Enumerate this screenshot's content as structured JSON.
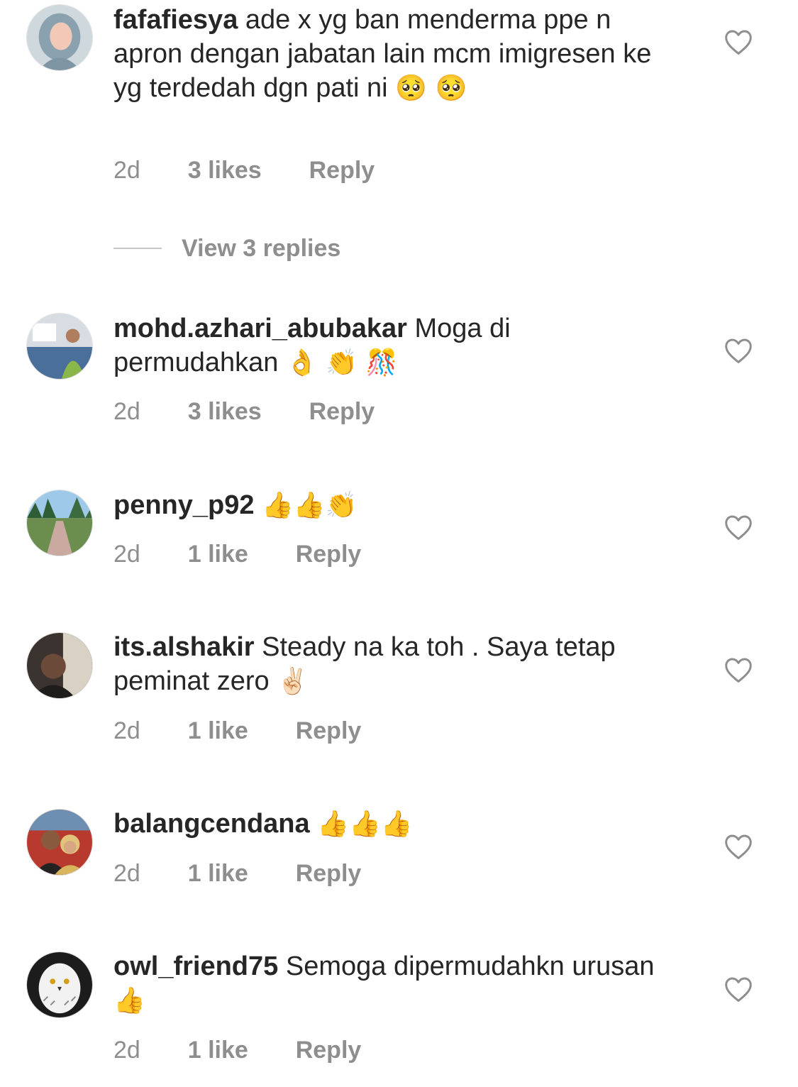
{
  "comments": [
    {
      "username": "fafafiesya",
      "text": "ade x yg ban menderma ppe n apron dengan jabatan lain mcm imigresen ke yg terdedah dgn pati ni",
      "emoji": "🥺 🥺",
      "time": "2d",
      "likes": "3 likes",
      "reply": "Reply"
    },
    {
      "username": "mohd.azhari_abubakar",
      "text": "Moga di permudahkan",
      "emoji": "👌 👏 🎊",
      "time": "2d",
      "likes": "3 likes",
      "reply": "Reply"
    },
    {
      "username": "penny_p92",
      "text": "",
      "emoji": "👍👍👏",
      "time": "2d",
      "likes": "1 like",
      "reply": "Reply"
    },
    {
      "username": "its.alshakir",
      "text": "Steady na ka toh . Saya tetap peminat zero",
      "emoji": "✌🏻",
      "time": "2d",
      "likes": "1 like",
      "reply": "Reply"
    },
    {
      "username": "balangcendana",
      "text": "",
      "emoji": "👍👍👍",
      "time": "2d",
      "likes": "1 like",
      "reply": "Reply"
    },
    {
      "username": "owl_friend75",
      "text": "Semoga dipermudahkn urusan",
      "emoji": "👍",
      "time": "2d",
      "likes": "1 like",
      "reply": "Reply"
    }
  ],
  "view_replies": "View 3 replies",
  "icons": {
    "like": "heart-outline-icon"
  },
  "colors": {
    "text": "#262626",
    "secondary": "#8e8e8e",
    "divider": "#c7c7c7"
  }
}
